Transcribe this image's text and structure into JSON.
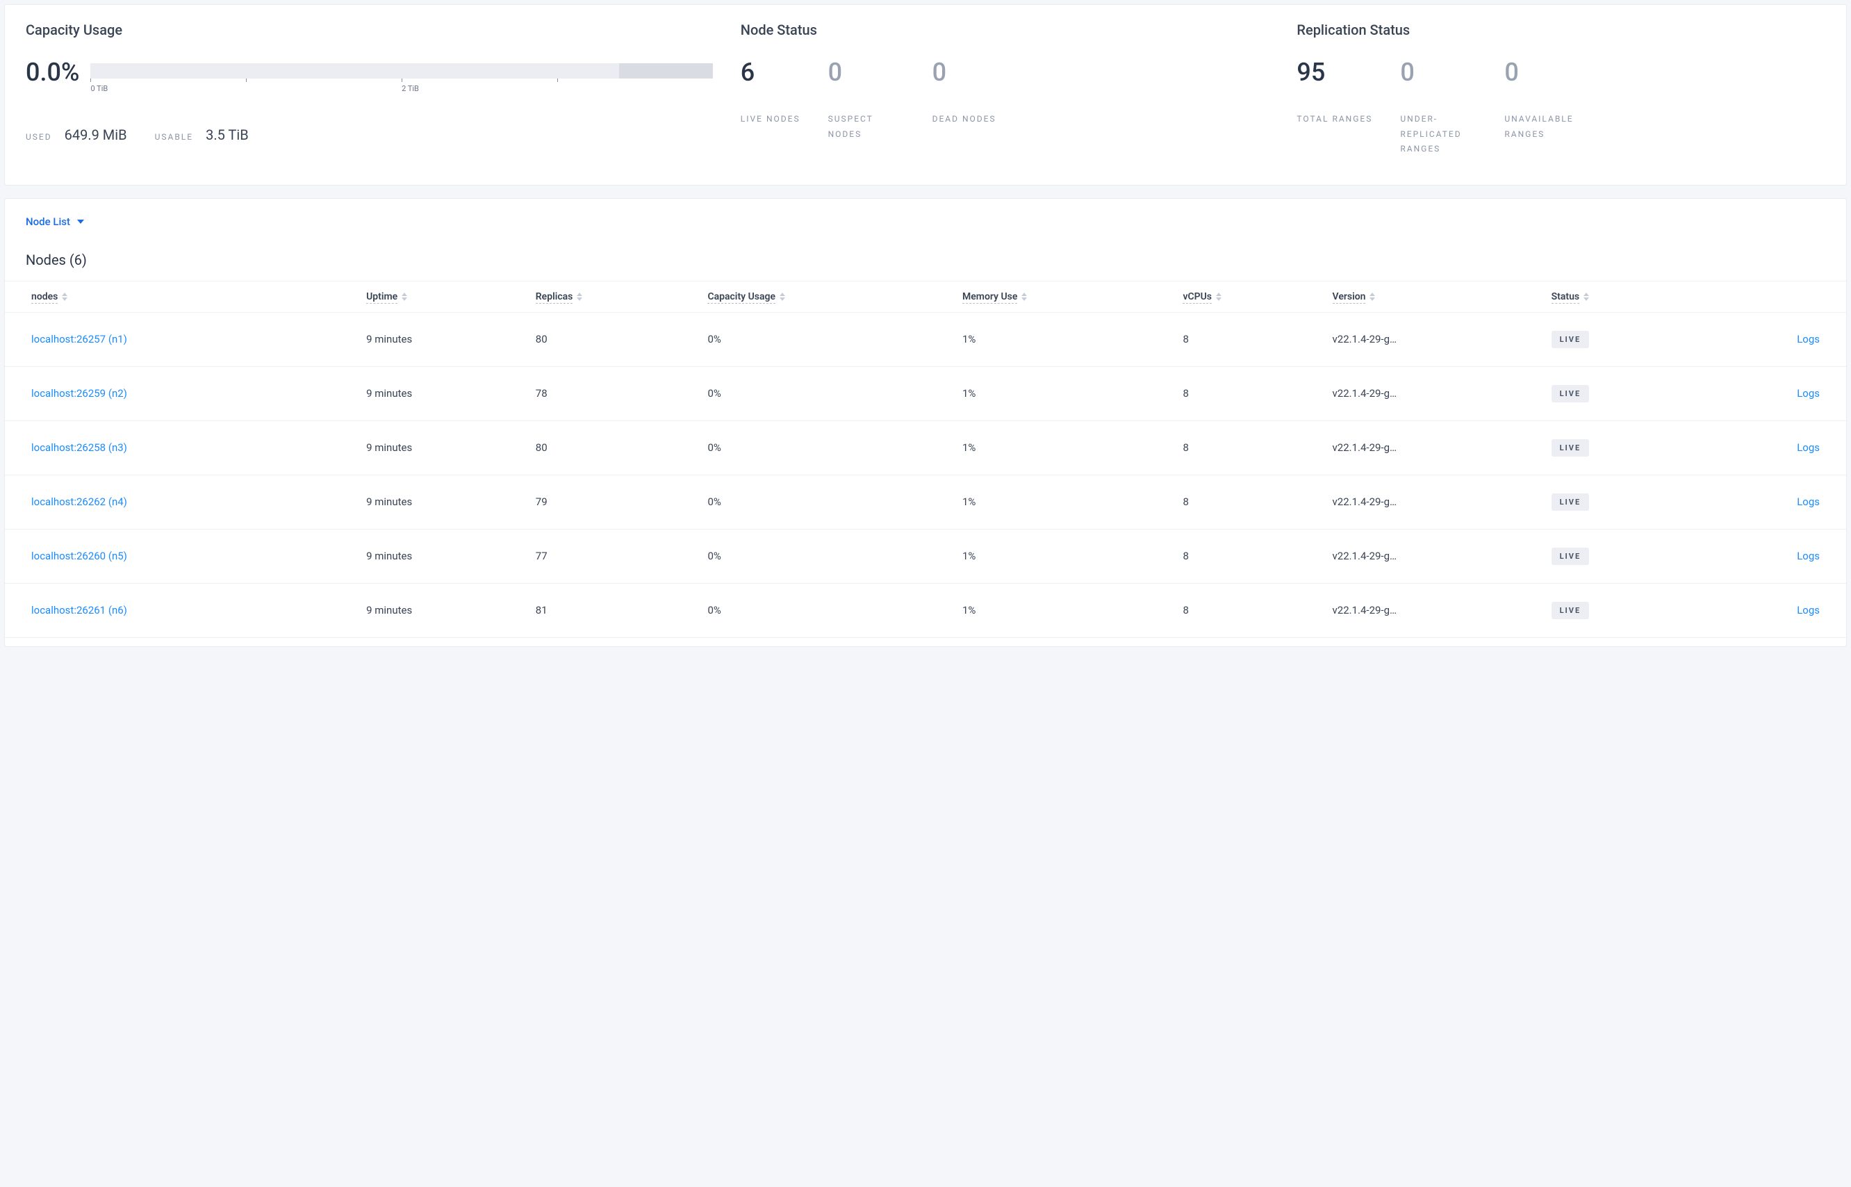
{
  "summary": {
    "capacity": {
      "title": "Capacity Usage",
      "percent": "0.0%",
      "ticks": [
        "0 TiB",
        "",
        "2 TiB",
        ""
      ],
      "used_label": "USED",
      "used_value": "649.9 MiB",
      "usable_label": "USABLE",
      "usable_value": "3.5 TiB"
    },
    "node_status": {
      "title": "Node Status",
      "items": [
        {
          "value": "6",
          "label": "LIVE NODES",
          "strong": true
        },
        {
          "value": "0",
          "label": "SUSPECT NODES",
          "strong": false
        },
        {
          "value": "0",
          "label": "DEAD NODES",
          "strong": false
        }
      ]
    },
    "replication_status": {
      "title": "Replication Status",
      "items": [
        {
          "value": "95",
          "label": "TOTAL RANGES",
          "strong": true
        },
        {
          "value": "0",
          "label": "UNDER-REPLICATED RANGES",
          "strong": false
        },
        {
          "value": "0",
          "label": "UNAVAILABLE RANGES",
          "strong": false
        }
      ]
    }
  },
  "node_list": {
    "dropdown_label": "Node List",
    "heading": "Nodes (6)",
    "columns": [
      "nodes",
      "Uptime",
      "Replicas",
      "Capacity Usage",
      "Memory Use",
      "vCPUs",
      "Version",
      "Status",
      ""
    ],
    "logs_label": "Logs",
    "rows": [
      {
        "node": "localhost:26257 (n1)",
        "uptime": "9 minutes",
        "replicas": "80",
        "capacity": "0%",
        "memory": "1%",
        "vcpus": "8",
        "version": "v22.1.4-29-g…",
        "status": "LIVE"
      },
      {
        "node": "localhost:26259 (n2)",
        "uptime": "9 minutes",
        "replicas": "78",
        "capacity": "0%",
        "memory": "1%",
        "vcpus": "8",
        "version": "v22.1.4-29-g…",
        "status": "LIVE"
      },
      {
        "node": "localhost:26258 (n3)",
        "uptime": "9 minutes",
        "replicas": "80",
        "capacity": "0%",
        "memory": "1%",
        "vcpus": "8",
        "version": "v22.1.4-29-g…",
        "status": "LIVE"
      },
      {
        "node": "localhost:26262 (n4)",
        "uptime": "9 minutes",
        "replicas": "79",
        "capacity": "0%",
        "memory": "1%",
        "vcpus": "8",
        "version": "v22.1.4-29-g…",
        "status": "LIVE"
      },
      {
        "node": "localhost:26260 (n5)",
        "uptime": "9 minutes",
        "replicas": "77",
        "capacity": "0%",
        "memory": "1%",
        "vcpus": "8",
        "version": "v22.1.4-29-g…",
        "status": "LIVE"
      },
      {
        "node": "localhost:26261 (n6)",
        "uptime": "9 minutes",
        "replicas": "81",
        "capacity": "0%",
        "memory": "1%",
        "vcpus": "8",
        "version": "v22.1.4-29-g…",
        "status": "LIVE"
      }
    ]
  }
}
